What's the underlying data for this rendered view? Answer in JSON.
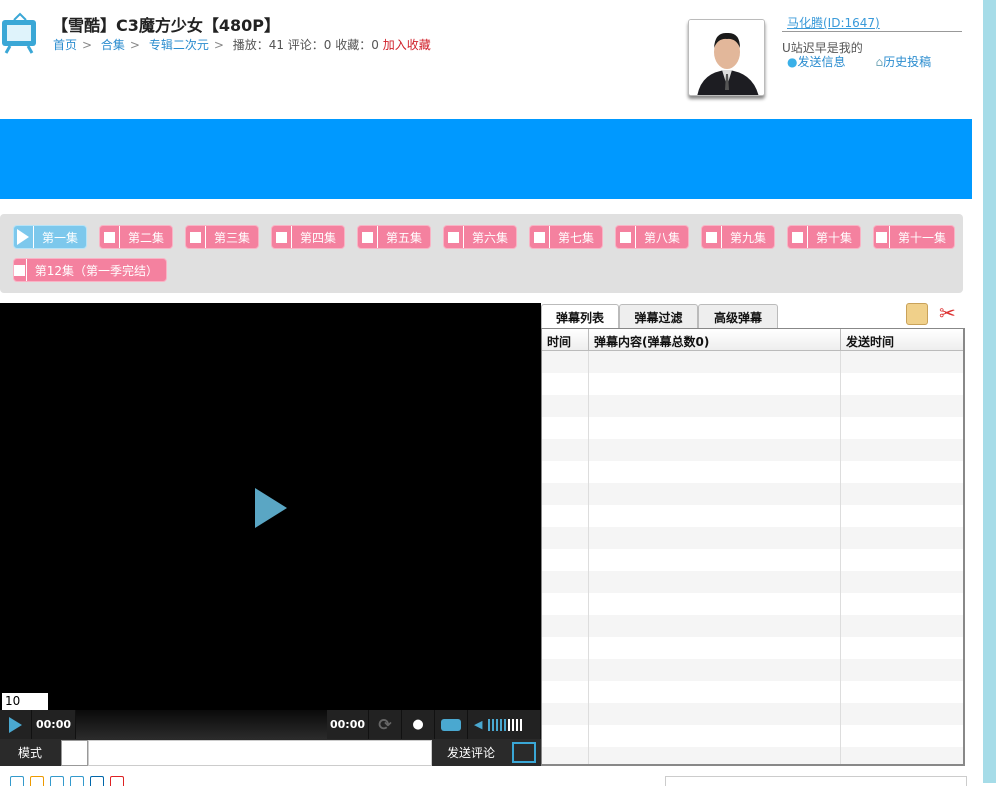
{
  "header": {
    "title": "【雪酷】C3魔方少女【480P】",
    "breadcrumb": [
      "首页",
      "合集",
      "专辑二次元"
    ],
    "stats": "播放：41 评论：0 收藏：0",
    "favorite": "加入收藏"
  },
  "user": {
    "name": "马化腾(ID:1647)",
    "signature": "U站迟早是我的",
    "send_message": "发送信息",
    "history": "历史投稿"
  },
  "episodes": [
    "第一集",
    "第二集",
    "第三集",
    "第四集",
    "第五集",
    "第六集",
    "第七集",
    "第八集",
    "第九集",
    "第十集",
    "第十一集",
    "第12集（第一季完结）"
  ],
  "active_episode": 0,
  "player": {
    "speed": "10",
    "time_current": "00:00",
    "time_total": "00:00",
    "mode": "模式",
    "send_comment": "发送评论",
    "volume_bars": 9
  },
  "danmaku": {
    "tabs": [
      "弹幕列表",
      "弹幕过滤",
      "高级弹幕"
    ],
    "columns": [
      "时间",
      "弹幕内容(弹幕总数0)",
      "发送时间"
    ]
  },
  "colors": {
    "banner": "#0099ff",
    "episode": "#f4819f",
    "episode_active": "#7dc8ec"
  }
}
